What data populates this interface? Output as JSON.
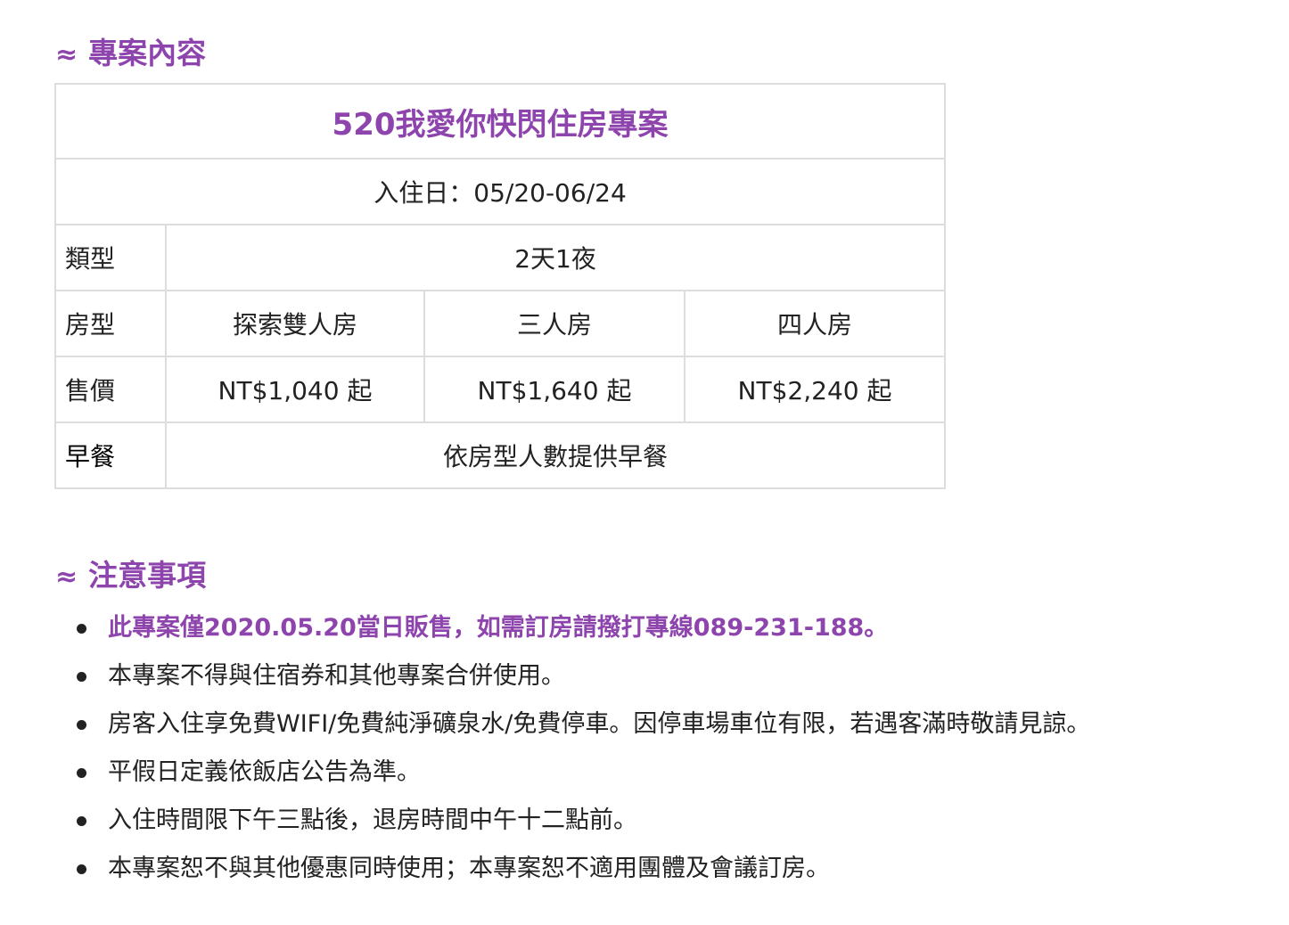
{
  "sections": {
    "content_heading": {
      "symbol": "≈",
      "text": "專案內容"
    },
    "notes_heading": {
      "symbol": "≈",
      "text": "注意事項"
    }
  },
  "plan_table": {
    "title": "520我愛你快閃住房專案",
    "checkin": "入住日：05/20-06/24",
    "type_label": "類型",
    "type_value": "2天1夜",
    "room_label": "房型",
    "rooms": [
      "探索雙人房",
      "三人房",
      "四人房"
    ],
    "price_label": "售價",
    "prices": [
      "NT$1,040 起",
      "NT$1,640 起",
      "NT$2,240 起"
    ],
    "breakfast_label": "早餐",
    "breakfast_value": "依房型人數提供早餐"
  },
  "notes": [
    "此專案僅2020.05.20當日販售，如需訂房請撥打專線089-231-188。",
    "本專案不得與住宿券和其他專案合併使用。",
    "房客入住享免費WIFI/免費純淨礦泉水/免費停車。因停車場車位有限，若遇客滿時敬請見諒。",
    "平假日定義依飯店公告為準。",
    "入住時間限下午三點後，退房時間中午十二點前。",
    "本專案恕不與其他優惠同時使用；本專案恕不適用團體及會議訂房。"
  ],
  "colors": {
    "accent": "#8e44ad",
    "text": "#222222",
    "border": "#dddddd"
  }
}
